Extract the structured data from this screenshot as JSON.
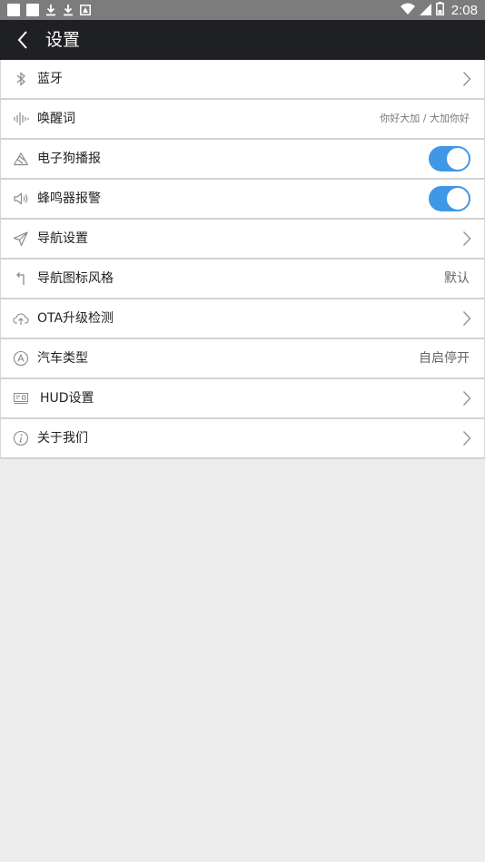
{
  "status_bar": {
    "time": "2:08",
    "left_icons": [
      "notification-square-icon",
      "notification-square-icon",
      "download-icon",
      "download-icon",
      "image-icon"
    ],
    "right_icons": [
      "wifi-icon",
      "signal-icon",
      "battery-icon"
    ]
  },
  "header": {
    "title": "设置",
    "background": "#1f2024"
  },
  "settings": [
    {
      "label": "蓝牙",
      "icon": "bluetooth-icon",
      "control": "chevron"
    },
    {
      "label": "唤醒词",
      "icon": "voice-wave-icon",
      "control": "value",
      "value": "你好大加 / 大加你好"
    },
    {
      "label": "电子狗播报",
      "icon": "radar-icon",
      "control": "toggle",
      "on": true
    },
    {
      "label": "蜂鸣器报警",
      "icon": "speaker-icon",
      "control": "toggle",
      "on": true
    },
    {
      "label": "导航设置",
      "icon": "navigation-arrow-icon",
      "control": "chevron"
    },
    {
      "label": "导航图标风格",
      "icon": "turn-arrow-icon",
      "control": "value",
      "value": "默认"
    },
    {
      "label": "OTA升级检测",
      "icon": "cloud-upload-icon",
      "control": "chevron"
    },
    {
      "label": "汽车类型",
      "icon": "auto-icon",
      "control": "value",
      "value": "自启停开"
    },
    {
      "label": "HUD设置",
      "icon": "hud-icon",
      "control": "chevron"
    },
    {
      "label": "关于我们",
      "icon": "info-icon",
      "control": "chevron"
    }
  ],
  "colors": {
    "toggle_on": "#3f97e6",
    "page_background": "#ececec"
  }
}
